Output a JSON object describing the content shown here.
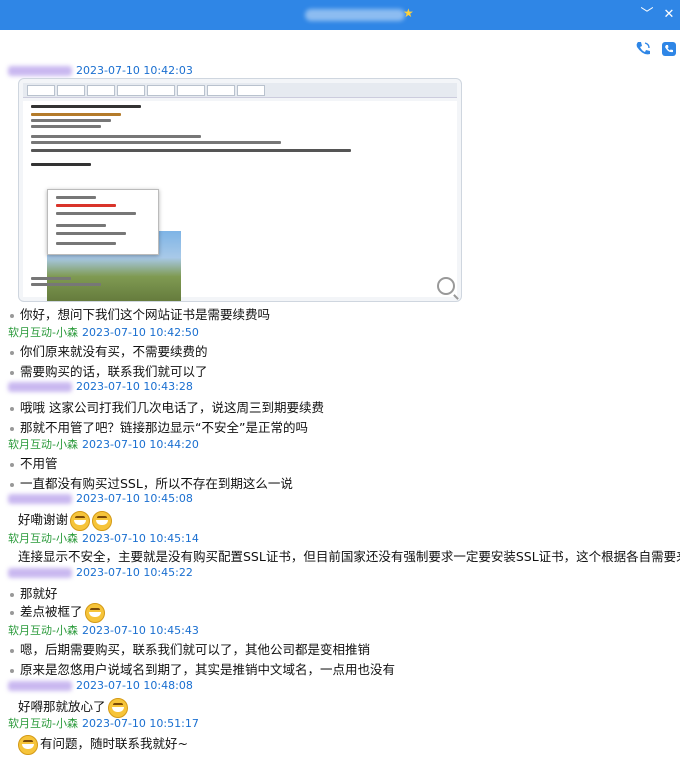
{
  "window": {
    "title_star": "★",
    "minimize_glyph": "﹀",
    "close_glyph": "✕"
  },
  "messages": [
    {
      "sender": "",
      "time": "2023-07-10 10:42:03"
    },
    {
      "text": "你好，想问下我们这个网站证书是需要续费吗"
    },
    {
      "sender": "软月互动-小森",
      "time": "2023-07-10 10:42:50"
    },
    {
      "text": "你们原来就没有买，不需要续费的"
    },
    {
      "text": "需要购买的话，联系我们就可以了"
    },
    {
      "sender": "",
      "time": "2023-07-10 10:43:28"
    },
    {
      "text": "哦哦 这家公司打我们几次电话了，说这周三到期要续费"
    },
    {
      "text": "那就不用管了吧？链接那边显示“不安全”是正常的吗"
    },
    {
      "sender": "软月互动-小森",
      "time": "2023-07-10 10:44:20"
    },
    {
      "text": "不用管"
    },
    {
      "text": "一直都没有购买过SSL，所以不存在到期这么一说"
    },
    {
      "sender": "",
      "time": "2023-07-10 10:45:08"
    },
    {
      "text": "好嘞谢谢"
    },
    {
      "sender": "软月互动-小森",
      "time": "2023-07-10 10:45:14"
    },
    {
      "text": "连接显示不安全，主要就是没有购买配置SSL证书，但目前国家还没有强制要求一定要安装SSL证书，这个根据各自需要来的"
    },
    {
      "sender": "",
      "time": "2023-07-10 10:45:22"
    },
    {
      "text": "那就好"
    },
    {
      "text": "差点被框了"
    },
    {
      "sender": "软月互动-小森",
      "time": "2023-07-10 10:45:43"
    },
    {
      "text": "嗯，后期需要购买，联系我们就可以了，其他公司都是变相推销"
    },
    {
      "text": "原来是忽悠用户说域名到期了，其实是推销中文域名，一点用也没有"
    },
    {
      "sender": "",
      "time": "2023-07-10 10:48:08"
    },
    {
      "text": "好嘚那就放心了"
    },
    {
      "sender": "软月互动-小森",
      "time": "2023-07-10 10:51:17"
    },
    {
      "text": "有问题，随时联系我就好~"
    }
  ]
}
